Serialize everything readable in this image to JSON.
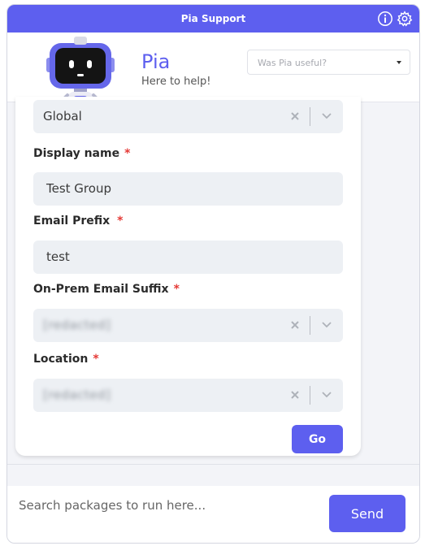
{
  "window": {
    "title": "Pia Support"
  },
  "header": {
    "bot_name": "Pia",
    "bot_tagline": "Here to help!",
    "feedback_select": {
      "placeholder": "Was Pia useful?"
    }
  },
  "form": {
    "scope_value": "Global",
    "display_name": {
      "label": "Display name",
      "required_mark": "*",
      "value": "Test Group"
    },
    "email_prefix": {
      "label": "Email Prefix",
      "required_mark": "*",
      "value": "test"
    },
    "onprem_suffix": {
      "label": "On-Prem Email Suffix",
      "required_mark": "*",
      "value": "[redacted]"
    },
    "location": {
      "label": "Location",
      "required_mark": "*",
      "value": "[redacted]"
    },
    "go_label": "Go"
  },
  "footer": {
    "search_placeholder": "Search packages to run here...",
    "send_label": "Send"
  },
  "icons": [
    "info-icon",
    "gear-icon",
    "robot-avatar",
    "chevron-down-icon",
    "clear-icon"
  ],
  "colors": {
    "accent": "#5d5fef",
    "required": "#e53935",
    "field_bg": "#edf0f4"
  }
}
